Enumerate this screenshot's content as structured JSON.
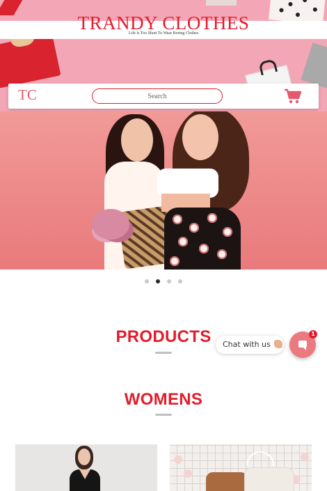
{
  "header": {
    "brand_title": "TRANDY CLOTHES",
    "tagline": "Life is Too Short To Wear Boring Clothes"
  },
  "navbar": {
    "logo": "TC",
    "search_placeholder": "Search",
    "cart_icon": "shopping-cart-icon"
  },
  "hero": {
    "slide_count": 4,
    "active_slide": 2
  },
  "sections": {
    "products_title": "PRODUCTS",
    "womens_title": "WOMENS"
  },
  "chat": {
    "label": "Chat with us",
    "badge_count": "1",
    "icon": "chat-bubble-icon"
  },
  "colors": {
    "brand_red": "#e11d2c",
    "banner_pink": "#f3a7b6",
    "chat_button": "#ea7a80"
  }
}
